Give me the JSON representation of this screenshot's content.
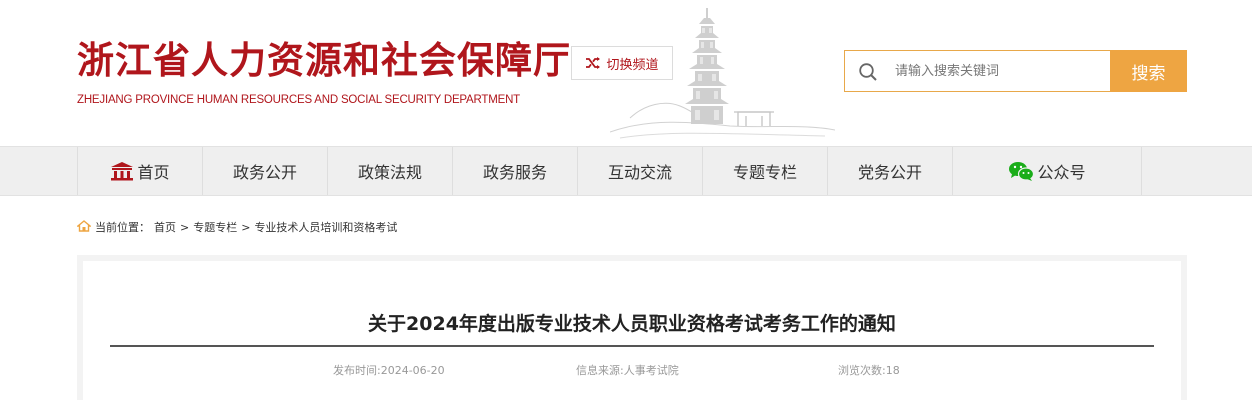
{
  "header": {
    "title": "浙江省人力资源和社会保障厅",
    "subtitle": "ZHEJIANG PROVINCE HUMAN RESOURCES AND SOCIAL SECURITY DEPARTMENT",
    "switch_label": "切换频道",
    "search": {
      "placeholder": "请输入搜索关键词",
      "button": "搜索"
    }
  },
  "nav": {
    "items": [
      {
        "label": "首页",
        "icon": "home-icon"
      },
      {
        "label": "政务公开"
      },
      {
        "label": "政策法规"
      },
      {
        "label": "政务服务"
      },
      {
        "label": "互动交流"
      },
      {
        "label": "专题专栏"
      },
      {
        "label": "党务公开"
      },
      {
        "label": "公众号",
        "icon": "wechat-icon"
      }
    ]
  },
  "breadcrumb": {
    "prefix": "当前位置：",
    "items": [
      "首页",
      "专题专栏",
      "专业技术人员培训和资格考试"
    ],
    "separator": ">"
  },
  "article": {
    "title": "关于2024年度出版专业技术人员职业资格考试考务工作的通知",
    "publish_time": "发布时间:2024-06-20",
    "source": "信息来源:人事考试院",
    "views": "浏览次数:18"
  },
  "colors": {
    "brand_red": "#b0161c",
    "accent_orange": "#eea542",
    "nav_bg": "#efefef"
  }
}
